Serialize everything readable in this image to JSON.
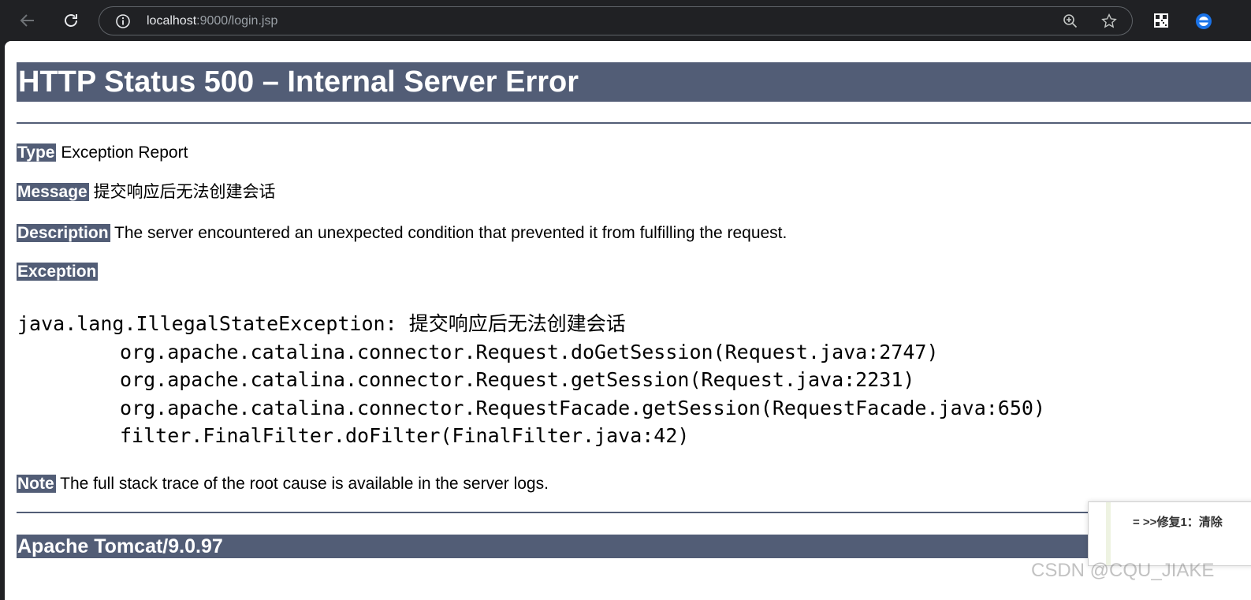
{
  "browser": {
    "url_host": "localhost",
    "url_rest": ":9000/login.jsp"
  },
  "page": {
    "title": "HTTP Status 500 – Internal Server Error",
    "type_label": "Type",
    "type_value": "Exception Report",
    "message_label": "Message",
    "message_value": "提交响应后无法创建会话",
    "description_label": "Description",
    "description_value": "The server encountered an unexpected condition that prevented it from fulfilling the request.",
    "exception_label": "Exception",
    "exception_header": "java.lang.IllegalStateException: 提交响应后无法创建会话",
    "stack_frames": [
      "org.apache.catalina.connector.Request.doGetSession(Request.java:2747)",
      "org.apache.catalina.connector.Request.getSession(Request.java:2231)",
      "org.apache.catalina.connector.RequestFacade.getSession(RequestFacade.java:650)",
      "filter.FinalFilter.doFilter(FinalFilter.java:42)"
    ],
    "note_label": "Note",
    "note_value": "The full stack trace of the root cause is available in the server logs.",
    "footer": "Apache Tomcat/9.0.97"
  },
  "overlay": {
    "popup_text": "= >>修复1：清除",
    "watermark": "CSDN @CQU_JIAKE"
  },
  "icons": {
    "back": "back-arrow-icon",
    "reload": "reload-icon",
    "info": "info-icon",
    "zoom": "zoom-icon",
    "bookmark": "star-icon",
    "qr": "qr-code-icon",
    "extension": "extension-icon"
  },
  "colors": {
    "tomcat_header": "#525D76",
    "chrome_bg": "#202124"
  }
}
